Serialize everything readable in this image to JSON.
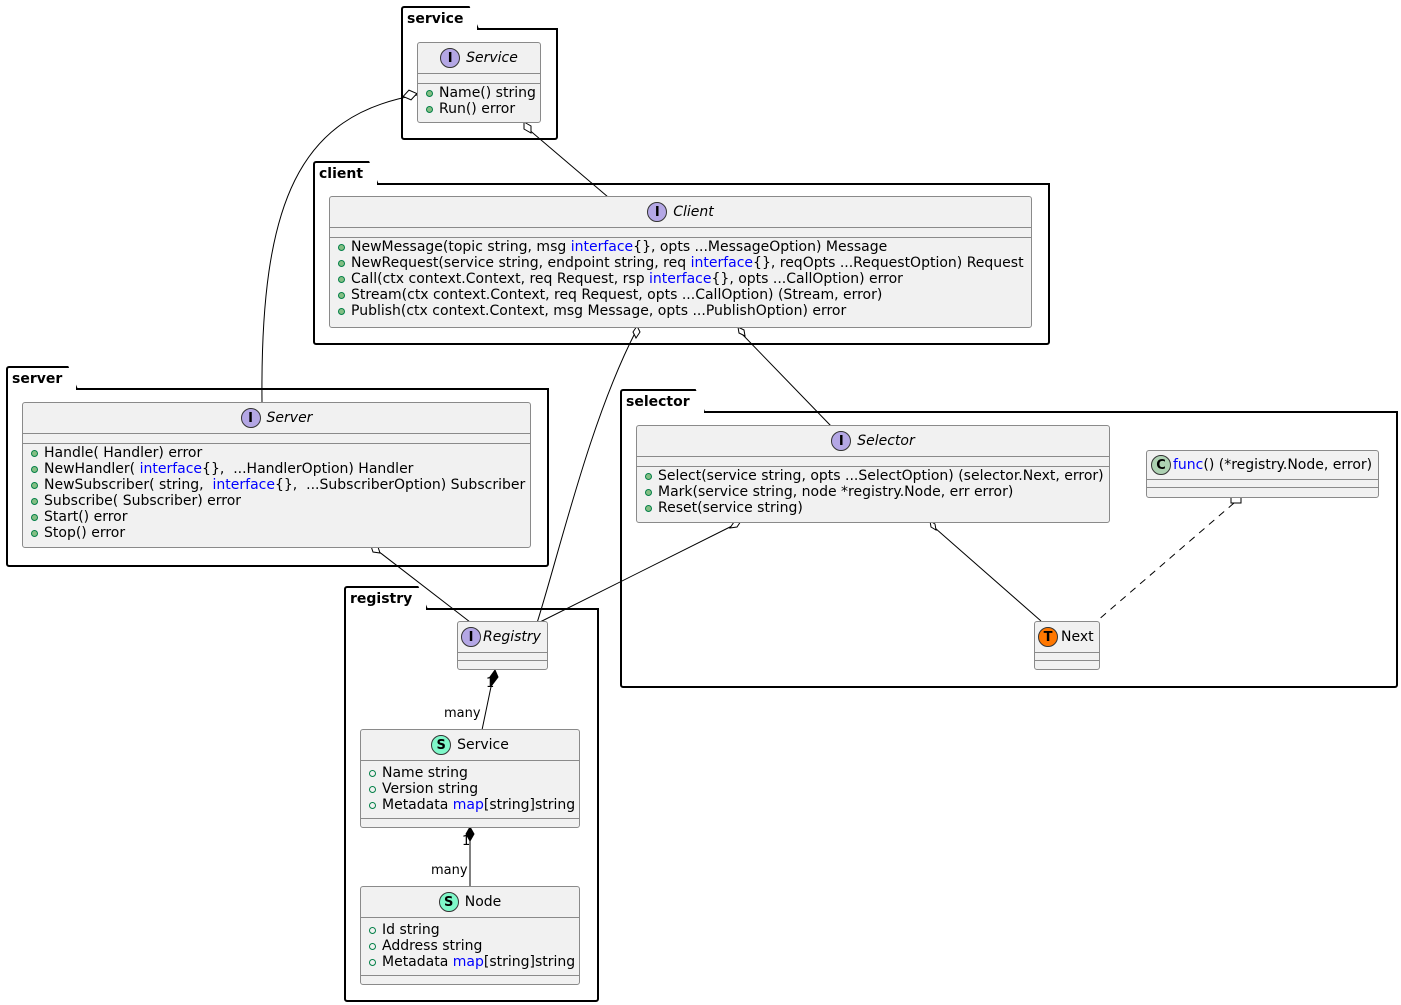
{
  "colors": {
    "interface_badge": "#b4a7e5",
    "class_badge": "#add1b2",
    "struct_badge": "#7ff8c9",
    "type_badge": "#ff7700",
    "keyword": "#0000ff",
    "class_fill": "#f1f1f1"
  },
  "packages": {
    "service": "service",
    "client": "client",
    "server": "server",
    "selector": "selector",
    "registry": "registry"
  },
  "classes": {
    "service_iface": {
      "badge": "I",
      "name": "Service",
      "members": [
        {
          "text": "Name() string"
        },
        {
          "text": "Run() error"
        }
      ]
    },
    "client_iface": {
      "badge": "I",
      "name": "Client",
      "members": [
        {
          "pre": "NewMessage(topic string, msg ",
          "kw": "interface",
          "post": "{}, opts ...MessageOption) Message"
        },
        {
          "pre": "NewRequest(service string, endpoint string, req ",
          "kw": "interface",
          "post": "{}, reqOpts ...RequestOption) Request"
        },
        {
          "pre": "Call(ctx context.Context, req Request, rsp ",
          "kw": "interface",
          "post": "{}, opts ...CallOption) error"
        },
        {
          "pre": "Stream(ctx context.Context, req Request, opts ...CallOption) (Stream, error)"
        },
        {
          "pre": "Publish(ctx context.Context, msg Message, opts ...PublishOption) error"
        }
      ]
    },
    "server_iface": {
      "badge": "I",
      "name": "Server",
      "members": [
        {
          "pre": "Handle( Handler) error"
        },
        {
          "pre": "NewHandler( ",
          "kw": "interface",
          "post": "{},  ...HandlerOption) Handler"
        },
        {
          "pre": "NewSubscriber( string,  ",
          "kw": "interface",
          "post": "{},  ...SubscriberOption) Subscriber"
        },
        {
          "pre": "Subscribe( Subscriber) error"
        },
        {
          "pre": "Start() error"
        },
        {
          "pre": "Stop() error"
        }
      ]
    },
    "selector_iface": {
      "badge": "I",
      "name": "Selector",
      "members": [
        {
          "pre": "Select(service string, opts ...SelectOption) (selector.Next, error)"
        },
        {
          "pre": "Mark(service string, node *registry.Node, err error)"
        },
        {
          "pre": "Reset(service string)"
        }
      ]
    },
    "func_class": {
      "badge": "C",
      "kw": "func",
      "name": "() (*registry.Node, error)"
    },
    "next_type": {
      "badge": "T",
      "name": "Next"
    },
    "registry_iface": {
      "badge": "I",
      "name": "Registry"
    },
    "service_struct": {
      "badge": "S",
      "name": "Service",
      "fields": [
        {
          "pre": "Name string"
        },
        {
          "pre": "Version string"
        },
        {
          "pre": "Metadata ",
          "kw": "map",
          "post": "[string]string"
        }
      ]
    },
    "node_struct": {
      "badge": "S",
      "name": "Node",
      "fields": [
        {
          "pre": "Id string"
        },
        {
          "pre": "Address string"
        },
        {
          "pre": "Metadata ",
          "kw": "map",
          "post": "[string]string"
        }
      ]
    }
  },
  "relations": {
    "registry_service": {
      "from_mult": "1",
      "to_mult": "many"
    },
    "service_node": {
      "from_mult": "1",
      "to_mult": "many"
    }
  }
}
